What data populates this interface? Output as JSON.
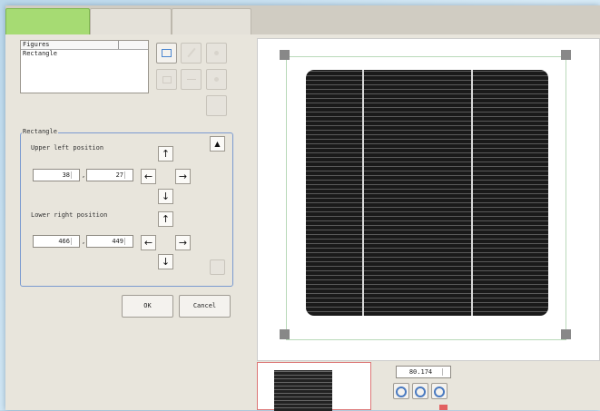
{
  "tabs": [
    "",
    "",
    ""
  ],
  "figures": {
    "header": "Figures",
    "items": [
      "Rectangle"
    ]
  },
  "group": {
    "title": "Rectangle",
    "upper_left": {
      "label": "Upper left position",
      "x": "38",
      "y": "27"
    },
    "lower_right": {
      "label": "Lower right position",
      "x": "466",
      "y": "449"
    }
  },
  "buttons": {
    "ok": "OK",
    "cancel": "Cancel"
  },
  "arrows": {
    "up": "↑",
    "down": "↓",
    "left": "←",
    "right": "→",
    "scroll_up": "▲"
  },
  "zoom": {
    "value": "80.174"
  },
  "colors": {
    "tab_active": "#a6db73",
    "group_border": "#7a9ad0",
    "panel": "#1a1a1a",
    "handle": "#888888",
    "guide": "#b9d9b9"
  },
  "icons": [
    "rectangle-tool-icon",
    "pencil-icon",
    "circle-icon",
    "polygon-icon",
    "line-icon",
    "add-icon",
    "zoom-in-icon",
    "zoom-fit-icon",
    "zoom-out-icon"
  ]
}
